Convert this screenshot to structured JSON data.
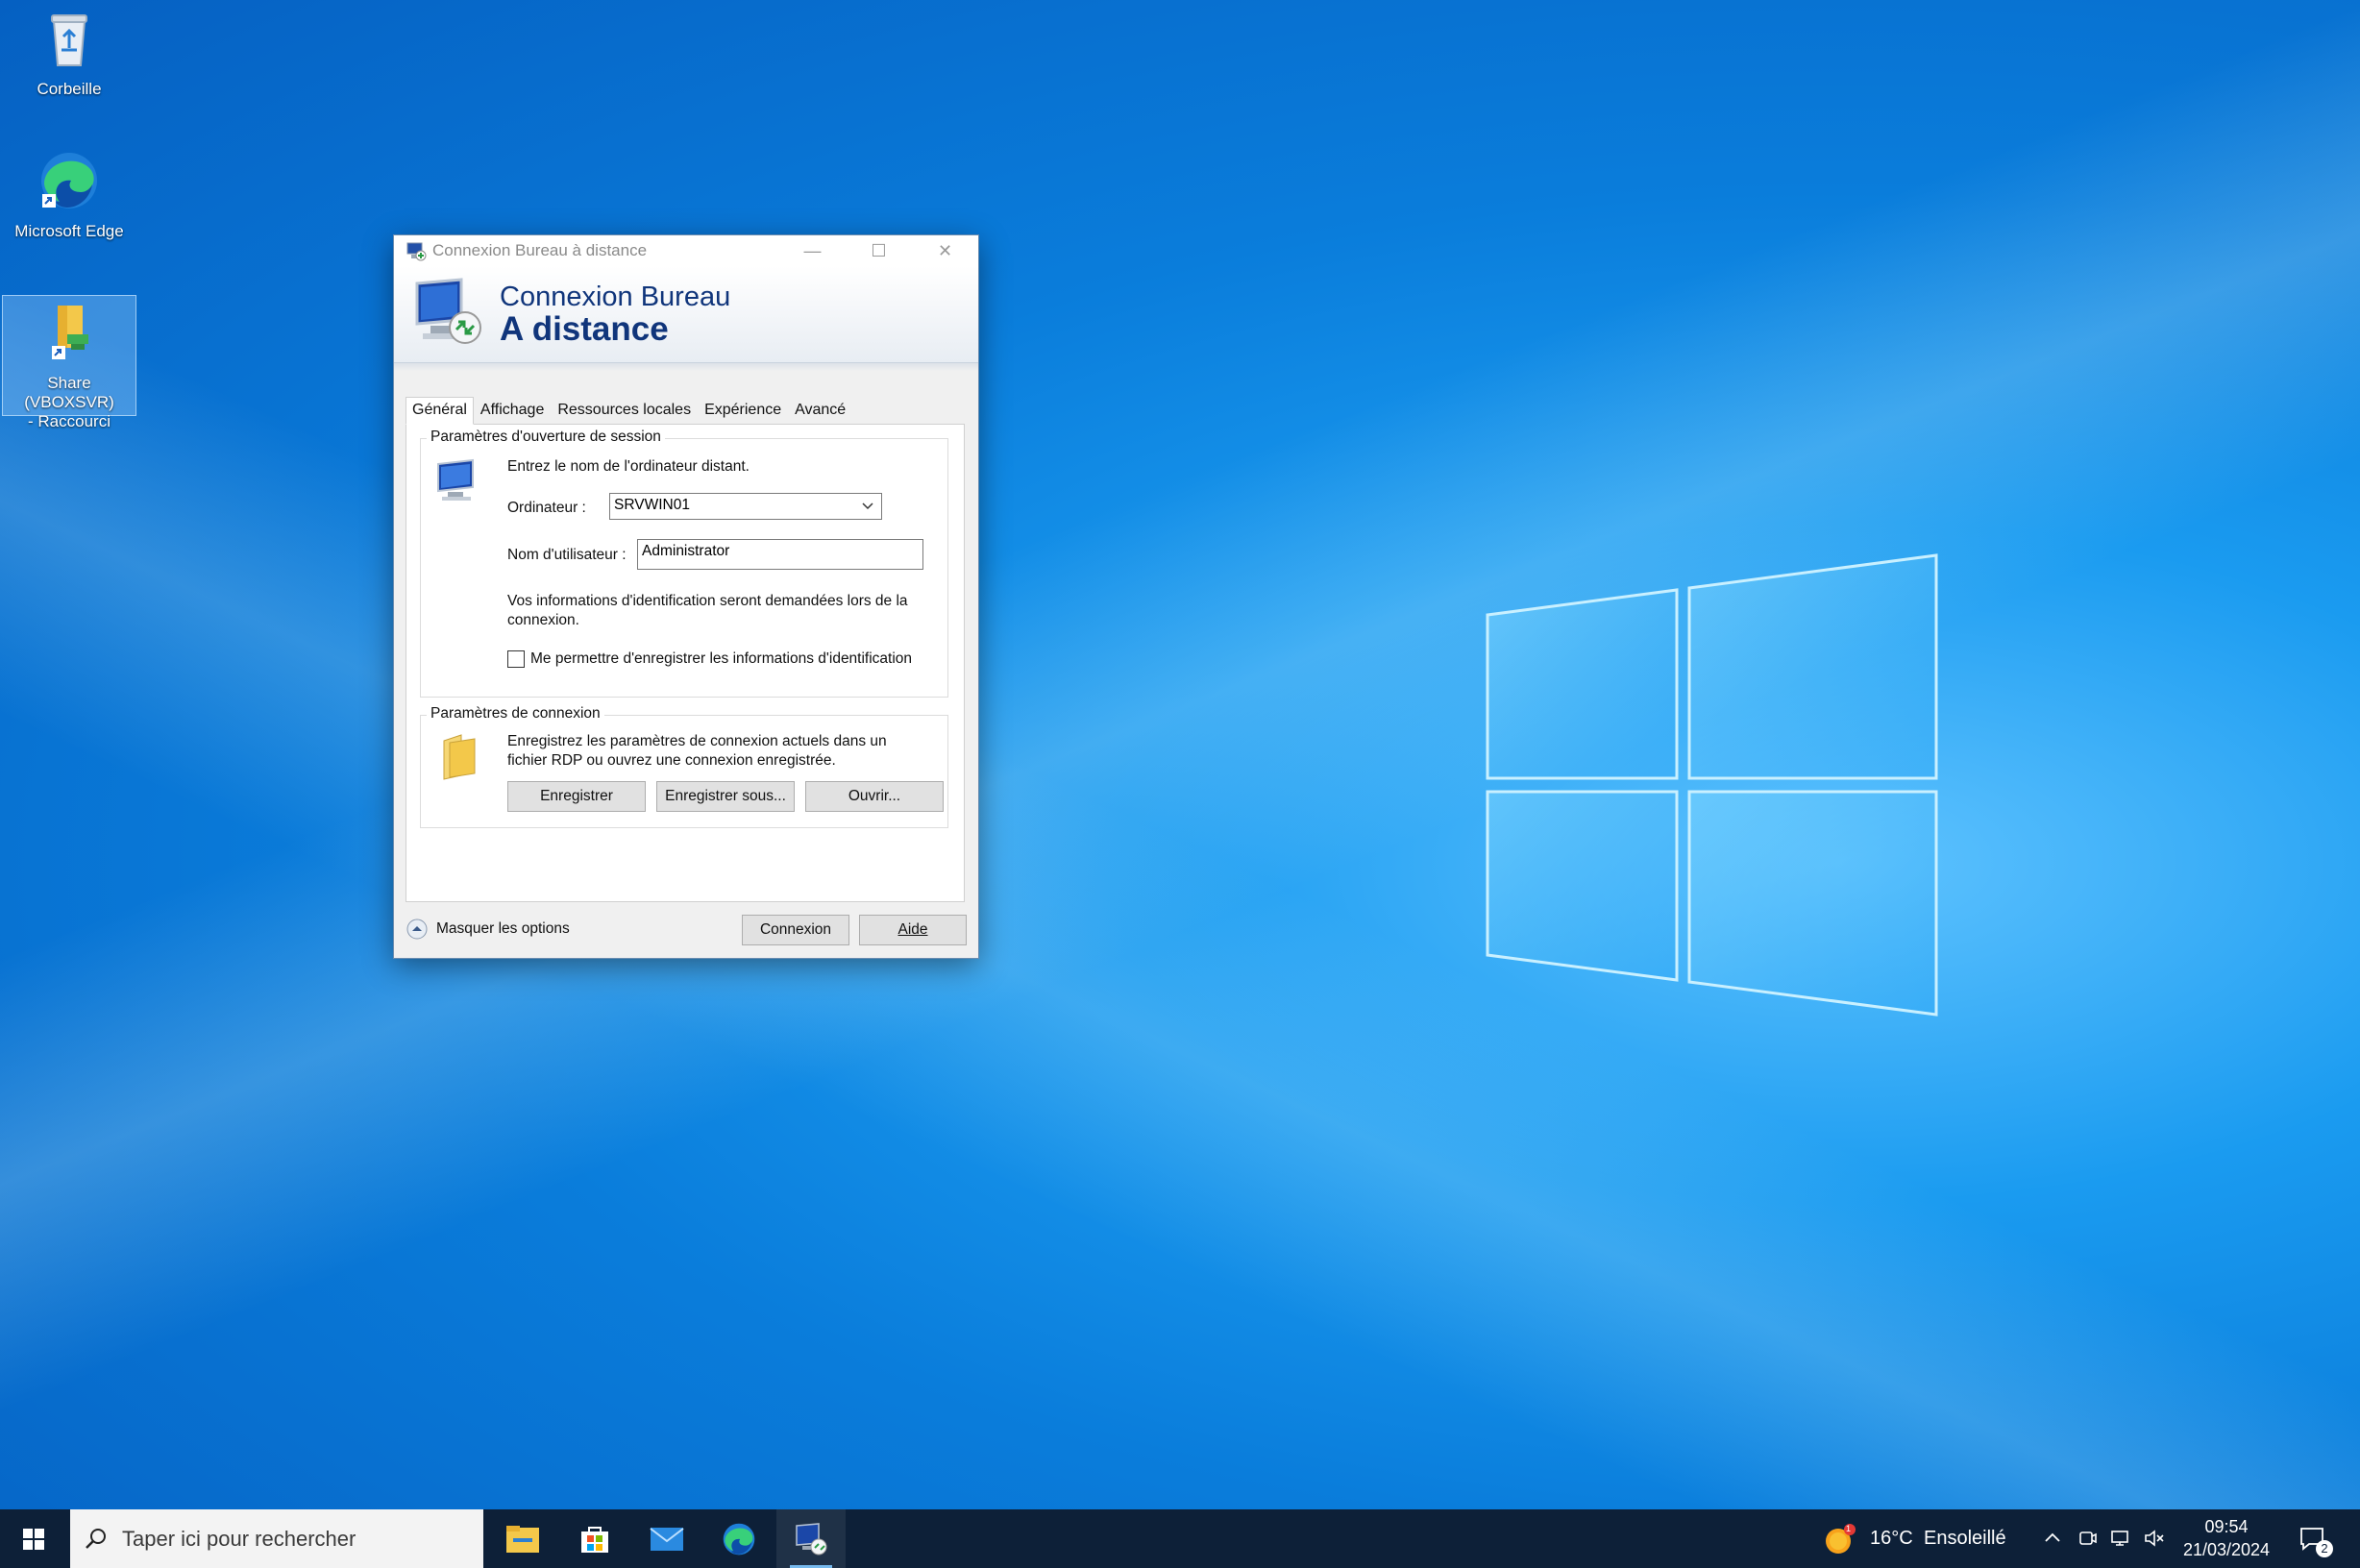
{
  "desktop": {
    "icons": [
      {
        "label": "Corbeille",
        "icon": "recycle-bin-icon"
      },
      {
        "label": "Microsoft Edge",
        "icon": "edge-icon"
      },
      {
        "label_line1": "Share (VBOXSVR)",
        "label_line2": "- Raccourci",
        "icon": "shared-folder-shortcut-icon"
      }
    ]
  },
  "dialog": {
    "window_title": "Connexion Bureau à distance",
    "banner_line1": "Connexion Bureau",
    "banner_line2": "A distance",
    "tabs": [
      "Général",
      "Affichage",
      "Ressources locales",
      "Expérience",
      "Avancé"
    ],
    "active_tab": "Général",
    "session_group": {
      "legend": "Paramètres d'ouverture de session",
      "instruction": "Entrez le nom de l'ordinateur distant.",
      "computer_label": "Ordinateur :",
      "computer_value": "SRVWIN01",
      "username_label": "Nom d'utilisateur :",
      "username_value": "Administrator",
      "credentials_note_line1": "Vos informations d'identification seront demandées lors de la",
      "credentials_note_line2": "connexion.",
      "save_credentials_label": "Me permettre d'enregistrer les informations d'identification",
      "save_credentials_checked": false
    },
    "connection_group": {
      "legend": "Paramètres de connexion",
      "description_line1": "Enregistrez les paramètres de connexion actuels dans un",
      "description_line2": "fichier RDP ou ouvrez une connexion enregistrée.",
      "save_button": "Enregistrer",
      "save_as_button": "Enregistrer sous...",
      "open_button": "Ouvrir..."
    },
    "hide_options_label": "Masquer les options",
    "connect_button": "Connexion",
    "help_button": "Aide"
  },
  "taskbar": {
    "search_placeholder": "Taper ici pour rechercher",
    "pinned_apps": [
      "file-explorer-icon",
      "microsoft-store-icon",
      "mail-icon",
      "edge-icon",
      "remote-desktop-icon"
    ],
    "weather": {
      "temperature": "16°C",
      "condition": "Ensoleillé",
      "badge": "1"
    },
    "clock": {
      "time": "09:54",
      "date": "21/03/2024"
    },
    "notifications_count": "2",
    "colors": {
      "taskbar_bg": "#0d2038",
      "accent": "#76b9ed"
    }
  }
}
